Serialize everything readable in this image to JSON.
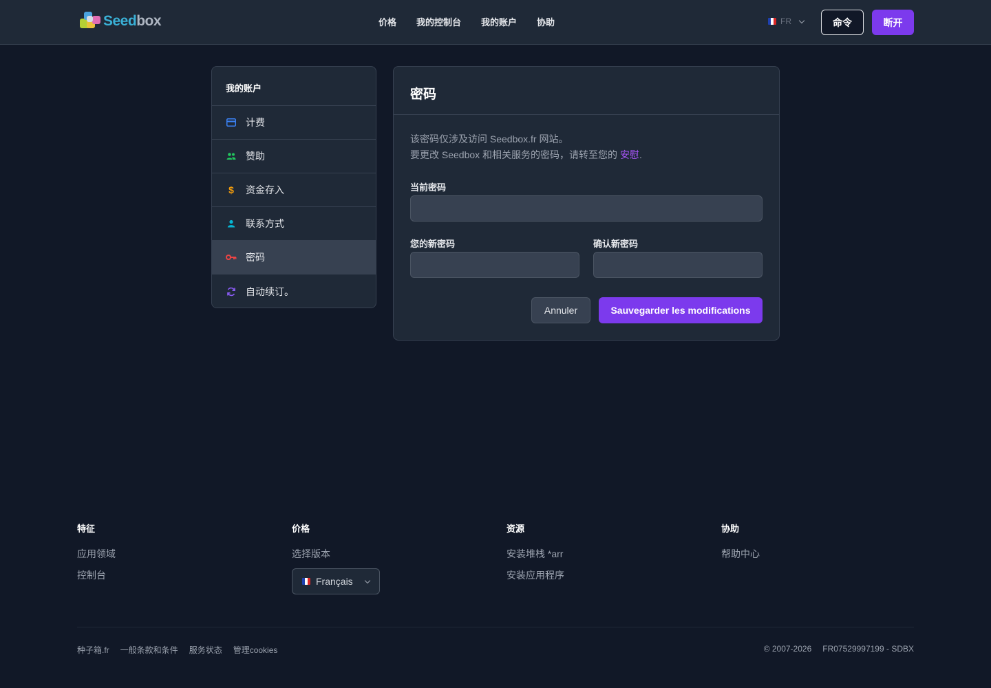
{
  "header": {
    "logo_text_a": "Seed",
    "logo_text_b": "box",
    "nav": [
      "价格",
      "我的控制台",
      "我的账户",
      "协助"
    ],
    "lang_code": "FR",
    "order_label": "命令",
    "logout_label": "断开"
  },
  "sidebar": {
    "title": "我的账户",
    "items": [
      {
        "label": "计费",
        "icon": "credit-card-icon",
        "color": "#3b82f6"
      },
      {
        "label": "赞助",
        "icon": "users-icon",
        "color": "#22c55e"
      },
      {
        "label": "资金存入",
        "icon": "dollar-icon",
        "color": "#f59e0b"
      },
      {
        "label": "联系方式",
        "icon": "user-icon",
        "color": "#06b6d4"
      },
      {
        "label": "密码",
        "icon": "key-icon",
        "color": "#ef4444",
        "active": true
      },
      {
        "label": "自动续订。",
        "icon": "refresh-icon",
        "color": "#8b5cf6"
      }
    ]
  },
  "password_card": {
    "title": "密码",
    "desc_line1": "该密码仅涉及访问 Seedbox.fr 网站。",
    "desc_line2": "要更改 Seedbox 和相关服务的密码，请转至您的 ",
    "desc_link": "安慰",
    "desc_end": ".",
    "current_label": "当前密码",
    "current_value": "",
    "new_label": "您的新密码",
    "new_value": "",
    "confirm_label": "确认新密码",
    "confirm_value": "",
    "cancel_label": "Annuler",
    "save_label": "Sauvegarder les modifications"
  },
  "footer": {
    "columns": [
      {
        "title": "特征",
        "links": [
          "应用领域",
          "控制台"
        ]
      },
      {
        "title": "价格",
        "links": [
          "选择版本"
        ]
      },
      {
        "title": "资源",
        "links": [
          "安装堆栈 *arr",
          "安装应用程序"
        ]
      },
      {
        "title": "协助",
        "links": [
          "帮助中心"
        ]
      }
    ],
    "language_select": "Français",
    "bottom_links": [
      "种子箱.fr",
      "一般条款和条件",
      "服务状态",
      "管理cookies"
    ],
    "copyright": "© 2007-2026",
    "company_id": "FR07529997199 - SDBX"
  },
  "colors": {
    "accent": "#7c3aed",
    "link": "#a855f7"
  }
}
